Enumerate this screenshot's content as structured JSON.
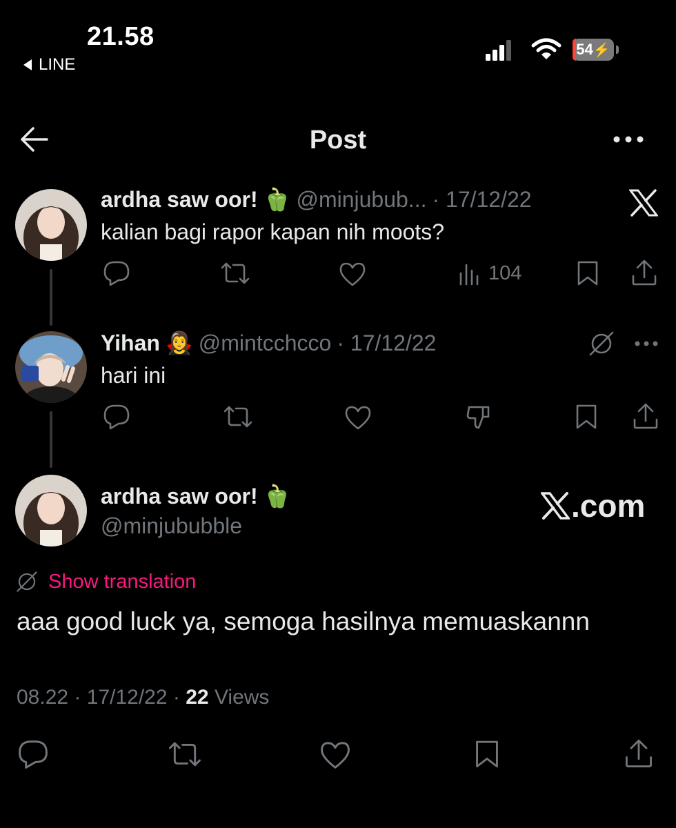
{
  "status_bar": {
    "time": "21.58",
    "back_app": "LINE",
    "battery": "54"
  },
  "nav": {
    "title": "Post"
  },
  "tweets": [
    {
      "name": "ardha saw oor!",
      "emoji": "🫑",
      "handle": "@minjubub...",
      "date": "· 17/12/22",
      "text": "kalian bagi rapor kapan nih moots?",
      "views": "104"
    },
    {
      "name": "Yihan",
      "emoji": "🧛‍♀️",
      "handle": "@mintcchcco",
      "date": "· 17/12/22",
      "text": "hari ini"
    }
  ],
  "main_post": {
    "name": "ardha saw oor!",
    "emoji": "🫑",
    "handle": "@minjububble",
    "show_translation": "Show translation",
    "text": "aaa good luck ya, semoga hasilnya memuaskannn",
    "time": "08.22",
    "date": "17/12/22",
    "sep": "·",
    "views_count": "22",
    "views_label": "Views"
  },
  "watermark": {
    "text": ".com"
  },
  "colors": {
    "background": "#000000",
    "text": "#e7e9ea",
    "muted": "#71767b",
    "accent_pink": "#f91880"
  }
}
